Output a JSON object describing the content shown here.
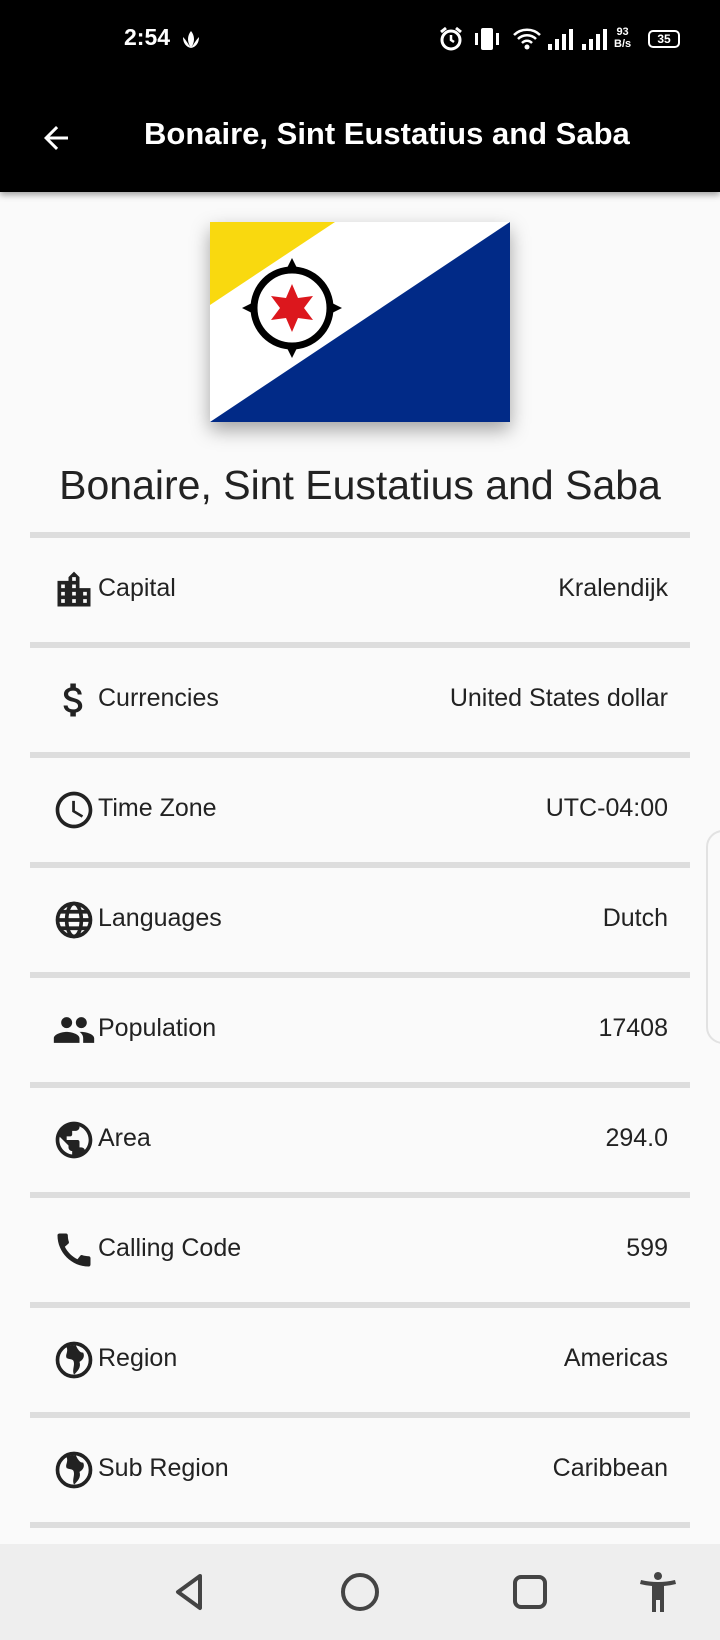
{
  "status_bar": {
    "time": "2:54",
    "net_speed_value": "93",
    "net_speed_unit": "B/s",
    "battery": "35"
  },
  "app_bar": {
    "title": "Bonaire, Sint Eustatius and Saba"
  },
  "country": {
    "name": "Bonaire, Sint Eustatius and Saba",
    "flag_colors": {
      "yellow": "#f9d90f",
      "white": "#ffffff",
      "blue": "#012a87",
      "red": "#dc171d",
      "black": "#000000"
    }
  },
  "details": [
    {
      "icon": "building-icon",
      "label": "Capital",
      "value": "Kralendijk"
    },
    {
      "icon": "dollar-icon",
      "label": "Currencies",
      "value": "United States dollar"
    },
    {
      "icon": "clock-icon",
      "label": "Time Zone",
      "value": "UTC-04:00"
    },
    {
      "icon": "globe-icon",
      "label": "Languages",
      "value": "Dutch"
    },
    {
      "icon": "people-icon",
      "label": "Population",
      "value": "17408"
    },
    {
      "icon": "public-globe-icon",
      "label": "Area",
      "value": "294.0"
    },
    {
      "icon": "phone-icon",
      "label": "Calling Code",
      "value": "599"
    },
    {
      "icon": "americas-globe-icon",
      "label": "Region",
      "value": "Americas"
    },
    {
      "icon": "americas-globe-icon",
      "label": "Sub Region",
      "value": "Caribbean"
    }
  ]
}
